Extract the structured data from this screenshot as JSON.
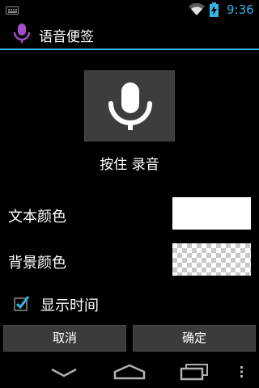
{
  "status_bar": {
    "time": "9:36",
    "icons": [
      "keyboard-icon",
      "wifi-icon",
      "battery-charging-icon"
    ],
    "accent_color": "#33b5e5"
  },
  "action_bar": {
    "title": "语音便签",
    "icon": "microphone-icon",
    "icon_color": "#a34fc6"
  },
  "record": {
    "icon": "microphone-icon",
    "label": "按住 录音"
  },
  "settings": {
    "text_color_label": "文本颜色",
    "text_color_value": "#ffffff",
    "bg_color_label": "背景颜色",
    "bg_color_value": "transparent",
    "show_time_label": "显示时间",
    "show_time_checked": true
  },
  "buttons": {
    "cancel": "取消",
    "ok": "确定"
  },
  "nav_bar": {
    "icons": [
      "back-icon",
      "home-icon",
      "recents-icon",
      "menu-icon"
    ]
  }
}
